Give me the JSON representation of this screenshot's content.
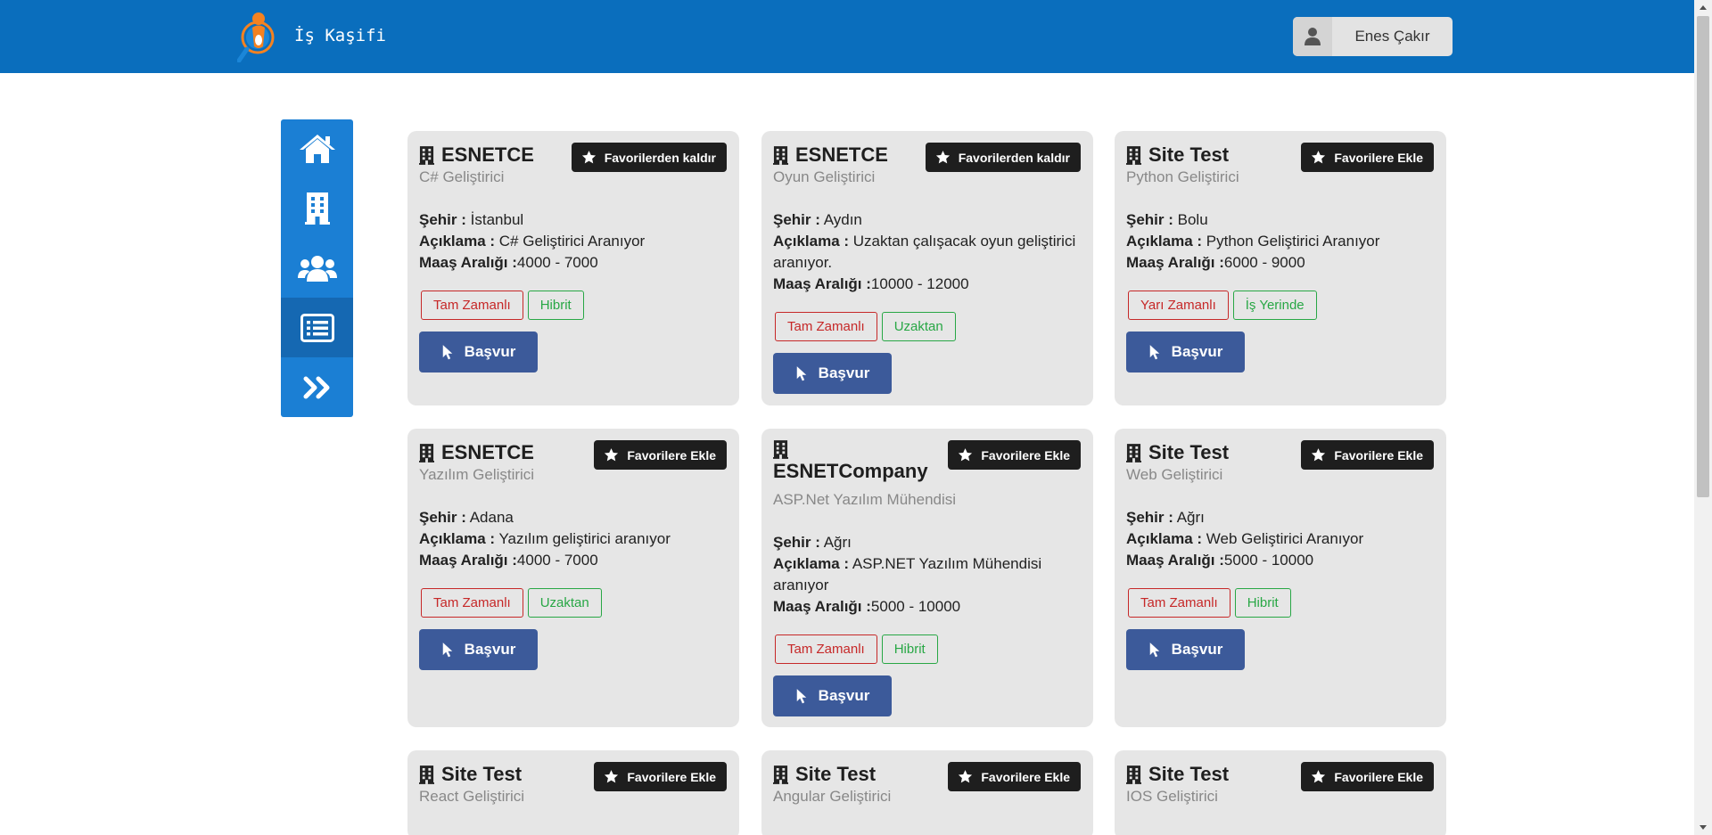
{
  "header": {
    "brand": "İş Kaşifi",
    "user_name": "Enes Çakır"
  },
  "sidebar": {
    "items": [
      {
        "icon": "home-icon"
      },
      {
        "icon": "building-icon"
      },
      {
        "icon": "users-icon"
      },
      {
        "icon": "list-icon",
        "active": true
      },
      {
        "icon": "angles-right-icon"
      }
    ]
  },
  "labels": {
    "city": "Şehir :",
    "desc": "Açıklama :",
    "salary": "Maaş Aralığı :",
    "apply": "Başvur"
  },
  "cards": [
    {
      "company": "ESNETCE",
      "position": "C# Geliştirici",
      "fav": "Favorilerden kaldır",
      "city": "İstanbul",
      "desc": "C# Geliştirici Aranıyor",
      "salary": "4000 - 7000",
      "tag1": "Tam Zamanlı",
      "tag2": "Hibrit"
    },
    {
      "company": "ESNETCE",
      "position": "Oyun Geliştirici",
      "fav": "Favorilerden kaldır",
      "city": "Aydın",
      "desc": "Uzaktan çalışacak oyun geliştirici aranıyor.",
      "salary": "10000 - 12000",
      "tag1": "Tam Zamanlı",
      "tag2": "Uzaktan"
    },
    {
      "company": "Site Test",
      "position": "Python Geliştirici",
      "fav": "Favorilere Ekle",
      "city": "Bolu",
      "desc": "Python Geliştirici Aranıyor",
      "salary": "6000 - 9000",
      "tag1": "Yarı Zamanlı",
      "tag2": "İş Yerinde"
    },
    {
      "company": "ESNETCE",
      "position": "Yazılım Geliştirici",
      "fav": "Favorilere Ekle",
      "city": "Adana",
      "desc": "Yazılım geliştirici aranıyor",
      "salary": "4000 - 7000",
      "tag1": "Tam Zamanlı",
      "tag2": "Uzaktan"
    },
    {
      "company": "ESNETCompany",
      "position": "ASP.Net Yazılım Mühendisi",
      "fav": "Favorilere Ekle",
      "city": "Ağrı",
      "desc": "ASP.NET Yazılım Mühendisi aranıyor",
      "salary": "5000 - 10000",
      "tag1": "Tam Zamanlı",
      "tag2": "Hibrit"
    },
    {
      "company": "Site Test",
      "position": "Web Geliştirici",
      "fav": "Favorilere Ekle",
      "city": "Ağrı",
      "desc": "Web Geliştirici Aranıyor",
      "salary": "5000 - 10000",
      "tag1": "Tam Zamanlı",
      "tag2": "Hibrit"
    },
    {
      "company": "Site Test",
      "position": "React Geliştirici",
      "fav": "Favorilere Ekle"
    },
    {
      "company": "Site Test",
      "position": "Angular Geliştirici",
      "fav": "Favorilere Ekle"
    },
    {
      "company": "Site Test",
      "position": "IOS Geliştirici",
      "fav": "Favorilere Ekle"
    }
  ]
}
